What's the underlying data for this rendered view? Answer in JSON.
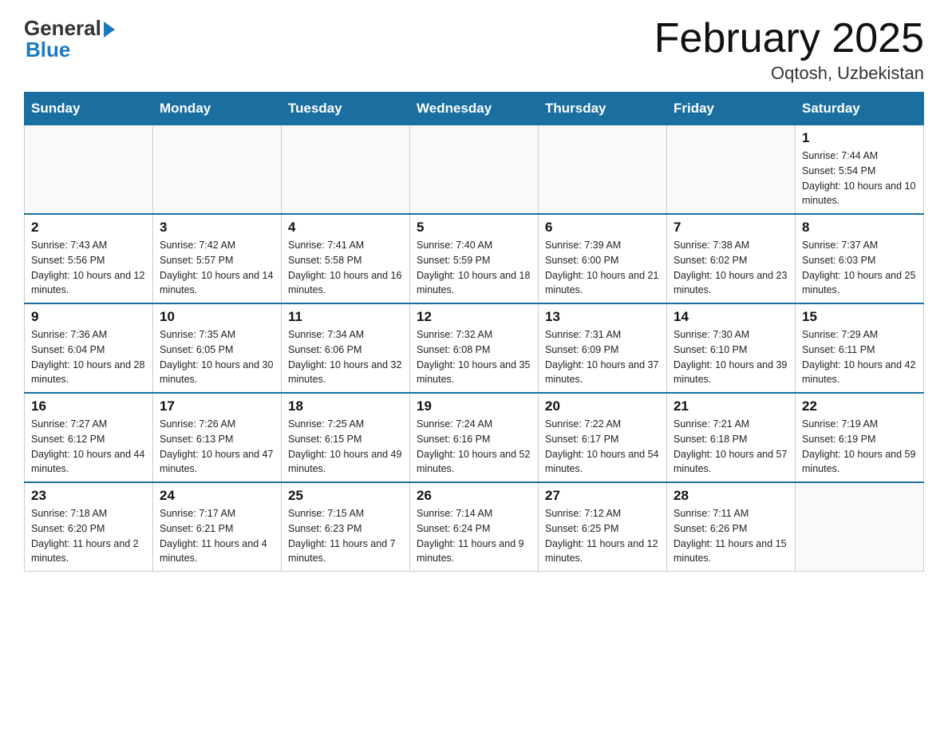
{
  "logo": {
    "general": "General",
    "blue": "Blue"
  },
  "title": "February 2025",
  "location": "Oqtosh, Uzbekistan",
  "days_of_week": [
    "Sunday",
    "Monday",
    "Tuesday",
    "Wednesday",
    "Thursday",
    "Friday",
    "Saturday"
  ],
  "weeks": [
    [
      {
        "num": "",
        "info": ""
      },
      {
        "num": "",
        "info": ""
      },
      {
        "num": "",
        "info": ""
      },
      {
        "num": "",
        "info": ""
      },
      {
        "num": "",
        "info": ""
      },
      {
        "num": "",
        "info": ""
      },
      {
        "num": "1",
        "info": "Sunrise: 7:44 AM\nSunset: 5:54 PM\nDaylight: 10 hours and 10 minutes."
      }
    ],
    [
      {
        "num": "2",
        "info": "Sunrise: 7:43 AM\nSunset: 5:56 PM\nDaylight: 10 hours and 12 minutes."
      },
      {
        "num": "3",
        "info": "Sunrise: 7:42 AM\nSunset: 5:57 PM\nDaylight: 10 hours and 14 minutes."
      },
      {
        "num": "4",
        "info": "Sunrise: 7:41 AM\nSunset: 5:58 PM\nDaylight: 10 hours and 16 minutes."
      },
      {
        "num": "5",
        "info": "Sunrise: 7:40 AM\nSunset: 5:59 PM\nDaylight: 10 hours and 18 minutes."
      },
      {
        "num": "6",
        "info": "Sunrise: 7:39 AM\nSunset: 6:00 PM\nDaylight: 10 hours and 21 minutes."
      },
      {
        "num": "7",
        "info": "Sunrise: 7:38 AM\nSunset: 6:02 PM\nDaylight: 10 hours and 23 minutes."
      },
      {
        "num": "8",
        "info": "Sunrise: 7:37 AM\nSunset: 6:03 PM\nDaylight: 10 hours and 25 minutes."
      }
    ],
    [
      {
        "num": "9",
        "info": "Sunrise: 7:36 AM\nSunset: 6:04 PM\nDaylight: 10 hours and 28 minutes."
      },
      {
        "num": "10",
        "info": "Sunrise: 7:35 AM\nSunset: 6:05 PM\nDaylight: 10 hours and 30 minutes."
      },
      {
        "num": "11",
        "info": "Sunrise: 7:34 AM\nSunset: 6:06 PM\nDaylight: 10 hours and 32 minutes."
      },
      {
        "num": "12",
        "info": "Sunrise: 7:32 AM\nSunset: 6:08 PM\nDaylight: 10 hours and 35 minutes."
      },
      {
        "num": "13",
        "info": "Sunrise: 7:31 AM\nSunset: 6:09 PM\nDaylight: 10 hours and 37 minutes."
      },
      {
        "num": "14",
        "info": "Sunrise: 7:30 AM\nSunset: 6:10 PM\nDaylight: 10 hours and 39 minutes."
      },
      {
        "num": "15",
        "info": "Sunrise: 7:29 AM\nSunset: 6:11 PM\nDaylight: 10 hours and 42 minutes."
      }
    ],
    [
      {
        "num": "16",
        "info": "Sunrise: 7:27 AM\nSunset: 6:12 PM\nDaylight: 10 hours and 44 minutes."
      },
      {
        "num": "17",
        "info": "Sunrise: 7:26 AM\nSunset: 6:13 PM\nDaylight: 10 hours and 47 minutes."
      },
      {
        "num": "18",
        "info": "Sunrise: 7:25 AM\nSunset: 6:15 PM\nDaylight: 10 hours and 49 minutes."
      },
      {
        "num": "19",
        "info": "Sunrise: 7:24 AM\nSunset: 6:16 PM\nDaylight: 10 hours and 52 minutes."
      },
      {
        "num": "20",
        "info": "Sunrise: 7:22 AM\nSunset: 6:17 PM\nDaylight: 10 hours and 54 minutes."
      },
      {
        "num": "21",
        "info": "Sunrise: 7:21 AM\nSunset: 6:18 PM\nDaylight: 10 hours and 57 minutes."
      },
      {
        "num": "22",
        "info": "Sunrise: 7:19 AM\nSunset: 6:19 PM\nDaylight: 10 hours and 59 minutes."
      }
    ],
    [
      {
        "num": "23",
        "info": "Sunrise: 7:18 AM\nSunset: 6:20 PM\nDaylight: 11 hours and 2 minutes."
      },
      {
        "num": "24",
        "info": "Sunrise: 7:17 AM\nSunset: 6:21 PM\nDaylight: 11 hours and 4 minutes."
      },
      {
        "num": "25",
        "info": "Sunrise: 7:15 AM\nSunset: 6:23 PM\nDaylight: 11 hours and 7 minutes."
      },
      {
        "num": "26",
        "info": "Sunrise: 7:14 AM\nSunset: 6:24 PM\nDaylight: 11 hours and 9 minutes."
      },
      {
        "num": "27",
        "info": "Sunrise: 7:12 AM\nSunset: 6:25 PM\nDaylight: 11 hours and 12 minutes."
      },
      {
        "num": "28",
        "info": "Sunrise: 7:11 AM\nSunset: 6:26 PM\nDaylight: 11 hours and 15 minutes."
      },
      {
        "num": "",
        "info": ""
      }
    ]
  ]
}
